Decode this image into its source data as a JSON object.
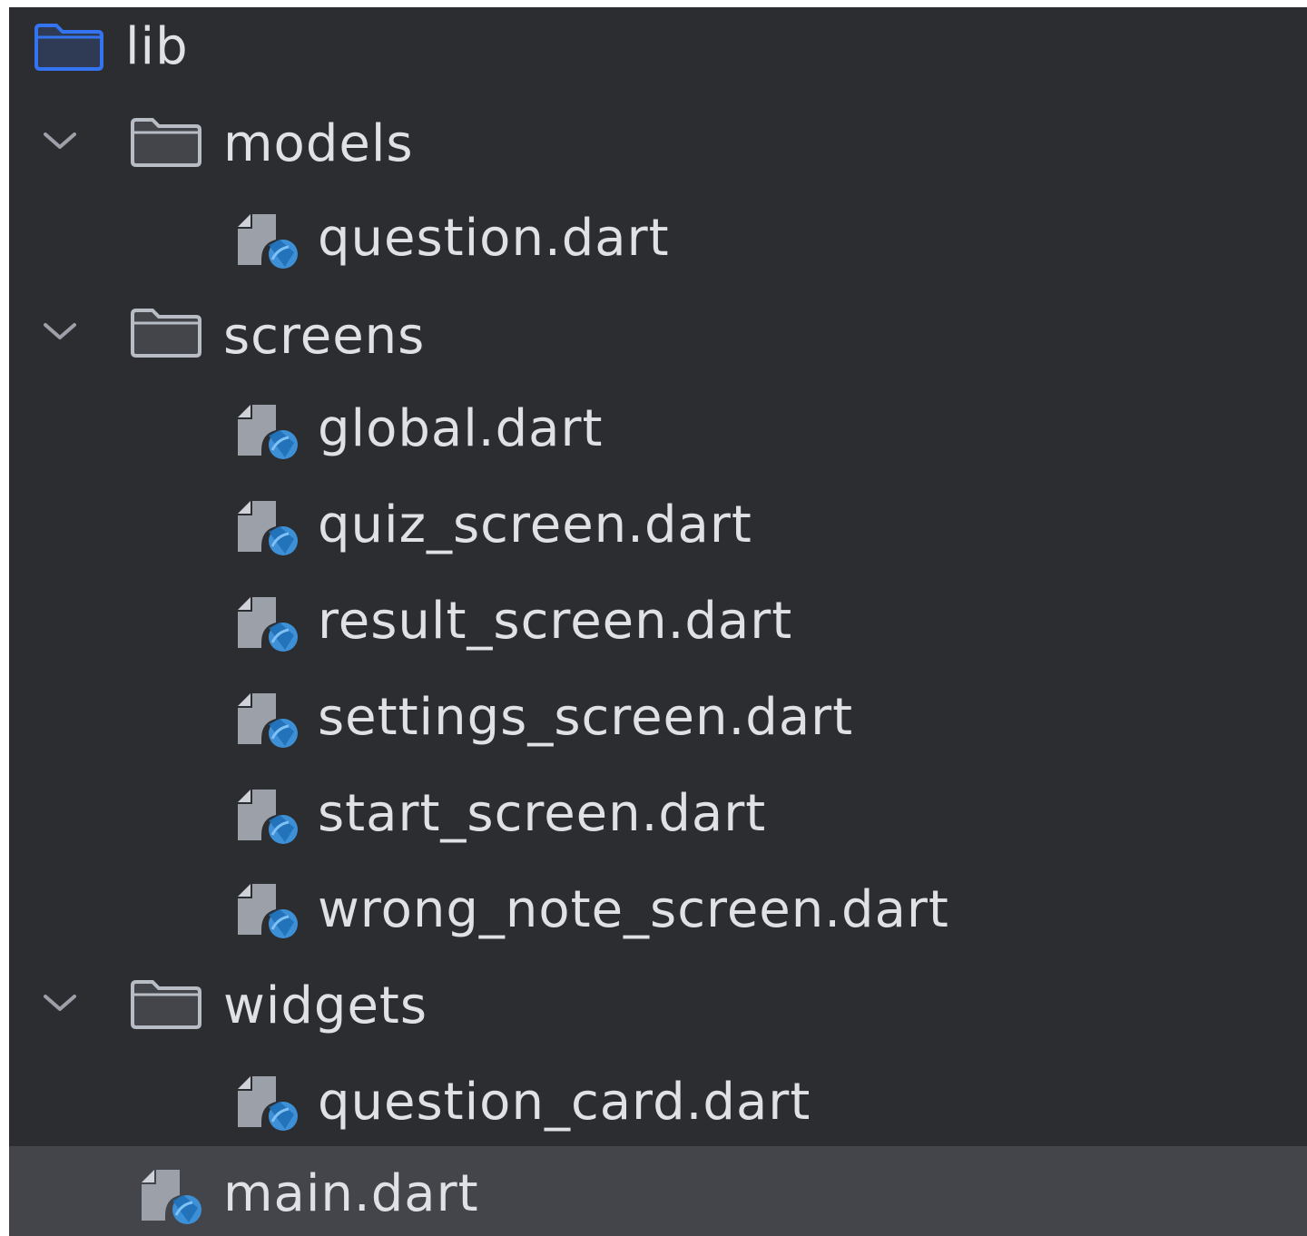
{
  "tree": {
    "root": {
      "label": "lib",
      "icon": "folder-icon",
      "color": "#3574f0"
    },
    "folders": [
      {
        "label": "models",
        "icon": "folder-icon",
        "expanded": true,
        "files": [
          {
            "label": "question.dart",
            "icon": "dart-file-icon"
          }
        ]
      },
      {
        "label": "screens",
        "icon": "folder-icon",
        "expanded": true,
        "files": [
          {
            "label": "global.dart",
            "icon": "dart-file-icon"
          },
          {
            "label": "quiz_screen.dart",
            "icon": "dart-file-icon"
          },
          {
            "label": "result_screen.dart",
            "icon": "dart-file-icon"
          },
          {
            "label": "settings_screen.dart",
            "icon": "dart-file-icon"
          },
          {
            "label": "start_screen.dart",
            "icon": "dart-file-icon"
          },
          {
            "label": "wrong_note_screen.dart",
            "icon": "dart-file-icon"
          }
        ]
      },
      {
        "label": "widgets",
        "icon": "folder-icon",
        "expanded": true,
        "files": [
          {
            "label": "question_card.dart",
            "icon": "dart-file-icon"
          }
        ]
      }
    ],
    "root_files": [
      {
        "label": "main.dart",
        "icon": "dart-file-icon",
        "selected": true
      }
    ]
  },
  "colors": {
    "background": "#2b2d30",
    "selected_row": "#43454a",
    "text": "#dfe1e5",
    "folder_outline": "#b8bcc4",
    "root_folder": "#3574f0",
    "dart_badge": "#3d8fd6"
  }
}
